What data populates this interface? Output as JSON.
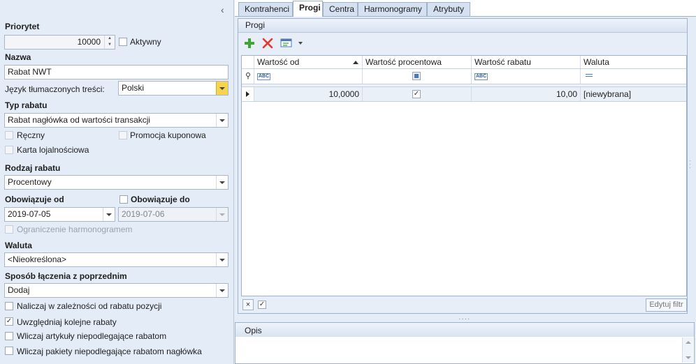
{
  "left_panel": {
    "collapse_label": "‹",
    "priorytet_label": "Priorytet",
    "priorytet_value": "10000",
    "aktywny_label": "Aktywny",
    "nazwa_label": "Nazwa",
    "nazwa_value": "Rabat NWT",
    "jezyk_label": "Język tłumaczonych treści:",
    "jezyk_value": "Polski",
    "typ_label": "Typ rabatu",
    "typ_value": "Rabat nagłówka od wartości transakcji",
    "reczny_label": "Ręczny",
    "promocja_label": "Promocja kuponowa",
    "karta_label": "Karta lojalnościowa",
    "rodzaj_label": "Rodzaj rabatu",
    "rodzaj_value": "Procentowy",
    "obow_od_label": "Obowiązuje od",
    "obow_od_value": "2019-07-05",
    "obow_do_label": "Obowiązuje do",
    "obow_do_value": "2019-07-06",
    "ograniczenie_label": "Ograniczenie harmonogramem",
    "waluta_label": "Waluta",
    "waluta_value": "<Nieokreślona>",
    "sposob_label": "Sposób łączenia z poprzednim",
    "sposob_value": "Dodaj",
    "naliczaj_label": "Naliczaj w zależności od rabatu pozycji",
    "uwzgledniaj_label": "Uwzględniaj kolejne rabaty",
    "wliczaj_art_label": "Wliczaj artykuły niepodlegające rabatom",
    "wliczaj_pak_label": "Wliczaj pakiety niepodlegające rabatom nagłówka"
  },
  "tabs": [
    "Kontrahenci",
    "Progi",
    "Centra",
    "Harmonogramy",
    "Atrybuty"
  ],
  "progi": {
    "group_title": "Progi",
    "columns": [
      "Wartość od",
      "Wartość procentowa",
      "Wartość rabatu",
      "Waluta"
    ],
    "filter_abc": "ABC",
    "row": {
      "wartosc_od": "10,0000",
      "wartosc_rabatu": "10,00",
      "waluta": "[niewybrana]"
    },
    "edit_filter_label": "Edytuj filtr"
  },
  "opis": {
    "title": "Opis"
  },
  "colors": {
    "accent_green": "#3fa535",
    "delete_red": "#e03a2f",
    "panel_bg": "#e4ecf7",
    "dropdown_yellow": "#f7d44d"
  }
}
